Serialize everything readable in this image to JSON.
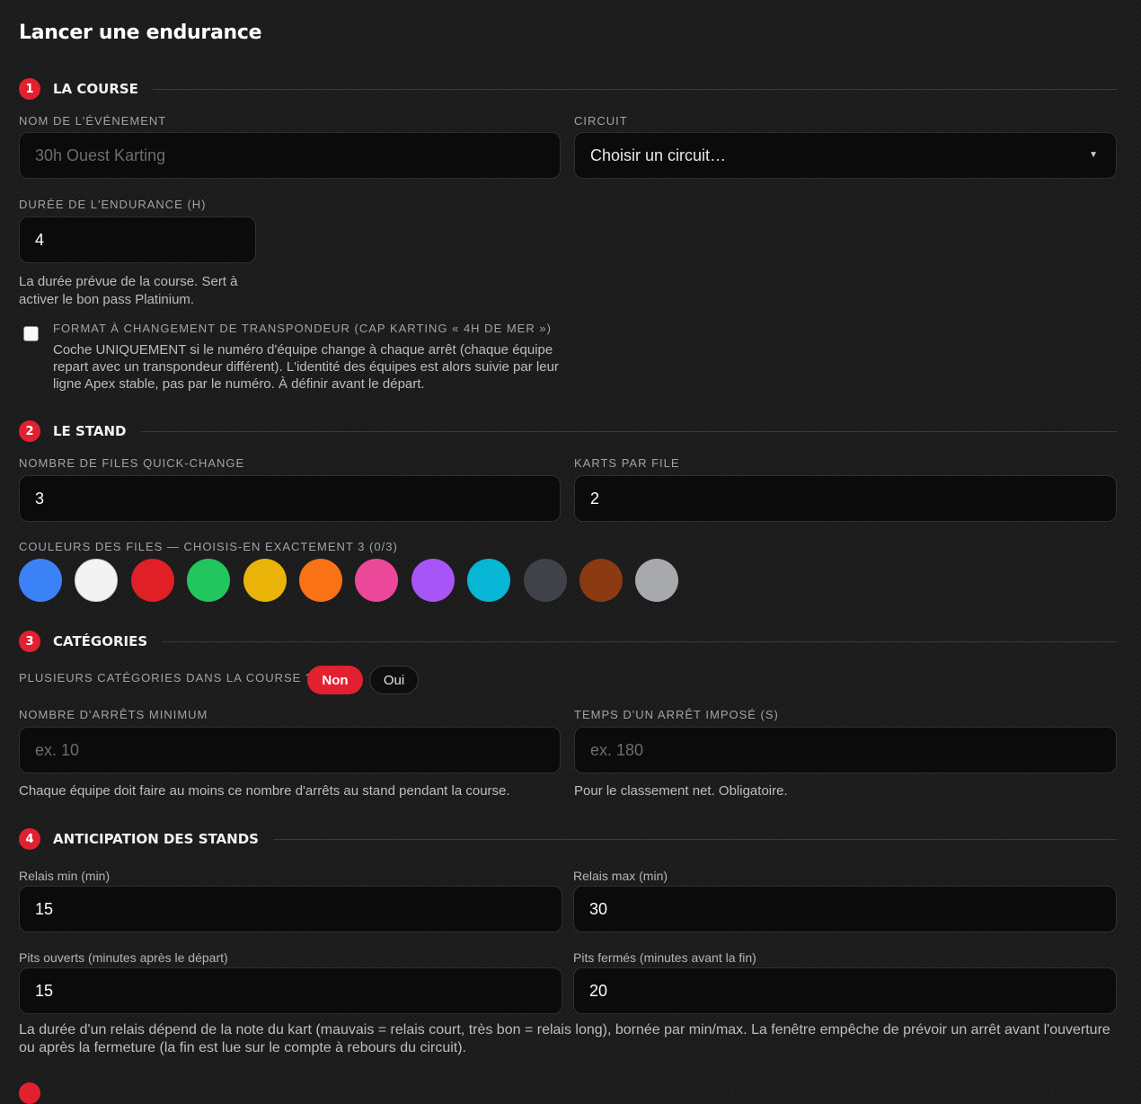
{
  "page_title": "Lancer une endurance",
  "sections": [
    {
      "number": "1",
      "title": "LA COURSE"
    },
    {
      "number": "2",
      "title": "LE STAND"
    },
    {
      "number": "3",
      "title": "CATÉGORIES"
    },
    {
      "number": "4",
      "title": "ANTICIPATION DES STANDS"
    }
  ],
  "course": {
    "event_name_label": "NOM DE L'ÉVÉNEMENT",
    "event_name_placeholder": "30h Ouest Karting",
    "circuit_label": "CIRCUIT",
    "circuit_value": "Choisir un circuit…",
    "duration_label": "DURÉE DE L'ENDURANCE (H)",
    "duration_value": "4",
    "duration_help": "La durée prévue de la course. Sert à activer le bon pass Platinium.",
    "transponder_title": "FORMAT À CHANGEMENT DE TRANSPONDEUR (CAP KARTING « 4H DE MER »)",
    "transponder_desc": "Coche UNIQUEMENT si le numéro d'équipe change à chaque arrêt (chaque équipe repart avec un transpondeur différent). L'identité des équipes est alors suivie par leur ligne Apex stable, pas par le numéro. À définir avant le départ.",
    "transponder_checked": false
  },
  "stand": {
    "lanes_label": "NOMBRE DE FILES QUICK-CHANGE",
    "lanes_value": "3",
    "karts_label": "KARTS PAR FILE",
    "karts_value": "2",
    "colors_label": "COULEURS DES FILES — CHOISIS-EN EXACTEMENT 3 (0/3)",
    "colors": [
      {
        "name": "blue",
        "hex": "#3b82f6"
      },
      {
        "name": "white",
        "hex": "#f3f3f3"
      },
      {
        "name": "red",
        "hex": "#e01f26"
      },
      {
        "name": "green",
        "hex": "#22c55e"
      },
      {
        "name": "yellow",
        "hex": "#eab308"
      },
      {
        "name": "orange",
        "hex": "#f97316"
      },
      {
        "name": "pink",
        "hex": "#ec4899"
      },
      {
        "name": "purple",
        "hex": "#a855f7"
      },
      {
        "name": "cyan",
        "hex": "#06b6d4"
      },
      {
        "name": "dark-gray",
        "hex": "#3f4249"
      },
      {
        "name": "brown",
        "hex": "#8b3a12"
      },
      {
        "name": "silver",
        "hex": "#a7a9ad"
      }
    ]
  },
  "categories": {
    "multi_label": "PLUSIEURS CATÉGORIES DANS LA COURSE ?",
    "no_label": "Non",
    "yes_label": "Oui",
    "min_stops_label": "NOMBRE D'ARRÊTS MINIMUM",
    "min_stops_placeholder": "ex. 10",
    "min_stops_help": "Chaque équipe doit faire au moins ce nombre d'arrêts au stand pendant la course.",
    "stop_time_label": "TEMPS D'UN ARRÊT IMPOSÉ (S)",
    "stop_time_placeholder": "ex. 180",
    "stop_time_help": "Pour le classement net. Obligatoire."
  },
  "anticipation": {
    "relay_min_label": "Relais min (min)",
    "relay_min_value": "15",
    "relay_max_label": "Relais max (min)",
    "relay_max_value": "30",
    "pits_open_label": "Pits ouverts (minutes après le départ)",
    "pits_open_value": "15",
    "pits_closed_label": "Pits fermés (minutes avant la fin)",
    "pits_closed_value": "20",
    "help": "La durée d'un relais dépend de la note du kart (mauvais = relais court, très bon = relais long), bornée par min/max. La fenêtre empêche de prévoir un arrêt avant l'ouverture ou après la fermeture (la fin est lue sur le compte à rebours du circuit)."
  },
  "theme": {
    "accent": "#e3202f",
    "field_bg": "#0b0b0b"
  }
}
